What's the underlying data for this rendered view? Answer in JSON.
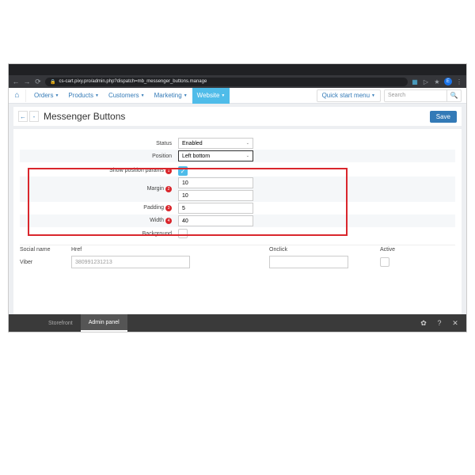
{
  "browser": {
    "url": "cs-cart.pixy.pro/admin.php?dispatch=mb_messenger_buttons.manage",
    "avatar_letter": "E"
  },
  "menu": {
    "orders": "Orders",
    "products": "Products",
    "customers": "Customers",
    "marketing": "Marketing",
    "website": "Website",
    "quick_start": "Quick start menu",
    "search_placeholder": "Search"
  },
  "page": {
    "title": "Messenger Buttons",
    "save": "Save"
  },
  "form": {
    "status_label": "Status",
    "status_value": "Enabled",
    "position_label": "Position",
    "position_value": "Left bottom",
    "show_params_label": "Show position params",
    "margin_label": "Margin",
    "margin_top": "10",
    "margin_bottom": "10",
    "padding_label": "Padding",
    "padding_value": "5",
    "width_label": "Width",
    "width_value": "40",
    "background_label": "Background"
  },
  "table": {
    "col_social": "Social name",
    "col_href": "Href",
    "col_onclick": "Onclick",
    "col_active": "Active",
    "row1_name": "Viber",
    "row1_href": "380991231213"
  },
  "bottom": {
    "tab1": "Storefront",
    "tab2": "Admin panel"
  }
}
